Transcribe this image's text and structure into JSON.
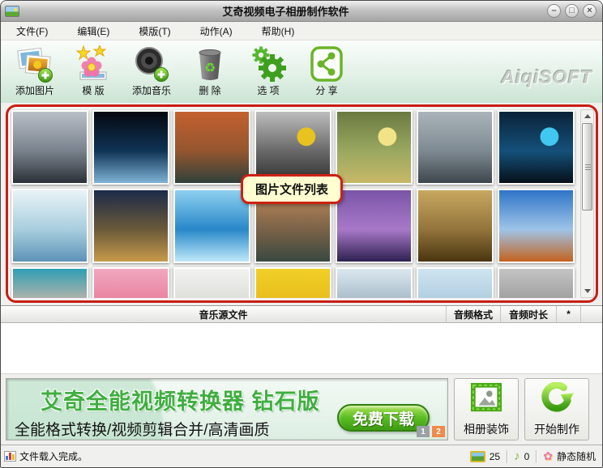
{
  "window": {
    "title": "艾奇视频电子相册制作软件",
    "controls": {
      "minimize": "–",
      "maximize": "□",
      "close": "×"
    }
  },
  "menu": {
    "items": [
      "文件(F)",
      "编辑(E)",
      "模版(T)",
      "动作(A)",
      "帮助(H)"
    ]
  },
  "toolbar": {
    "buttons": [
      {
        "label": "添加图片"
      },
      {
        "label": "模 版"
      },
      {
        "label": "添加音乐"
      },
      {
        "label": "删 除"
      },
      {
        "label": "选 项"
      },
      {
        "label": "分 享"
      }
    ],
    "logo": "AiqiSOFT"
  },
  "gallery": {
    "tooltip": "图片文件列表",
    "thumbnails": [
      {
        "name": "eiffel-tower-bw",
        "g": [
          "#b9bfc7",
          "#79828c",
          "#2c3138"
        ]
      },
      {
        "name": "earth-from-space",
        "g": [
          "#05080f",
          "#0f3355",
          "#7fb3d5"
        ]
      },
      {
        "name": "stonehenge-sunset",
        "g": [
          "#c4602f",
          "#94562f",
          "#30403b"
        ]
      },
      {
        "name": "zen-stones-flowers",
        "g": [
          "#bdbdbd",
          "#696969",
          "#2e2e2e"
        ],
        "accent": "#e8c21f"
      },
      {
        "name": "duckling",
        "g": [
          "#6a7a40",
          "#9aa860",
          "#c8b868"
        ],
        "accent": "#f2e388"
      },
      {
        "name": "ferris-wheel",
        "g": [
          "#aab4ba",
          "#7e8a92",
          "#3e464d"
        ]
      },
      {
        "name": "sydney-bridge-night",
        "g": [
          "#0a2238",
          "#14507a",
          "#061018"
        ],
        "accent": "#42c8f0"
      },
      {
        "name": "eiffel-winter-art",
        "g": [
          "#e9f3f7",
          "#a8cede",
          "#5d93b8"
        ]
      },
      {
        "name": "colosseum-night",
        "g": [
          "#1c2a4a",
          "#6a5a3a",
          "#c89a4a"
        ]
      },
      {
        "name": "blue-water-wave",
        "g": [
          "#8ed0f0",
          "#2888c8",
          "#bfe8fa"
        ]
      },
      {
        "name": "chambord-castle",
        "g": [
          "#c08a5a",
          "#7a6248",
          "#394940"
        ]
      },
      {
        "name": "tower-bridge-purple",
        "g": [
          "#7a55a8",
          "#a878c8",
          "#2e2150"
        ]
      },
      {
        "name": "eiffel-sepia",
        "g": [
          "#c8a85f",
          "#93743c",
          "#49350f"
        ]
      },
      {
        "name": "monument-valley",
        "g": [
          "#2f74c8",
          "#9ec4e8",
          "#c4621f"
        ]
      },
      {
        "name": "woman-face",
        "g": [
          "#2f9eb4",
          "#d8b8a8",
          "#8a5a4a"
        ]
      },
      {
        "name": "woman-in-pink",
        "g": [
          "#f0a8c0",
          "#e87898",
          "#f8d8c8"
        ]
      },
      {
        "name": "girl-portrait",
        "g": [
          "#f2f2f0",
          "#d8d8d4",
          "#3a3530"
        ]
      },
      {
        "name": "yellow-tulips",
        "g": [
          "#f0d028",
          "#e8b818",
          "#f8e868"
        ]
      },
      {
        "name": "penguins",
        "g": [
          "#dce8f0",
          "#9ab0be",
          "#23282d"
        ]
      },
      {
        "name": "beach-sky",
        "g": [
          "#cfe4f0",
          "#a8c8dc",
          "#7aa8c4"
        ]
      },
      {
        "name": "koala-bw",
        "g": [
          "#c4c4c4",
          "#969696",
          "#6a6a6a"
        ]
      }
    ]
  },
  "music_table": {
    "columns": [
      "音乐源文件",
      "音频格式",
      "音频时长",
      "*"
    ]
  },
  "banner": {
    "title": "艾奇全能视频转换器 钻石版",
    "subtitle": "全能格式转换/视频剪辑合并/高清画质",
    "download_label": "免费下载",
    "pages": [
      "1",
      "2"
    ],
    "page_colors": [
      "#9aa0a6",
      "#f08a4a"
    ]
  },
  "actions": {
    "decorate_label": "相册装饰",
    "start_label": "开始制作"
  },
  "status": {
    "message": "文件载入完成。",
    "image_count": "25",
    "music_count": "0",
    "mode_label": "静态随机",
    "icons": {
      "music_note": "♪",
      "flower": "✿"
    }
  },
  "colors": {
    "frame_red": "#c81e14",
    "button_green": "#4aa820",
    "banner_title_green": "#3fae3f"
  }
}
